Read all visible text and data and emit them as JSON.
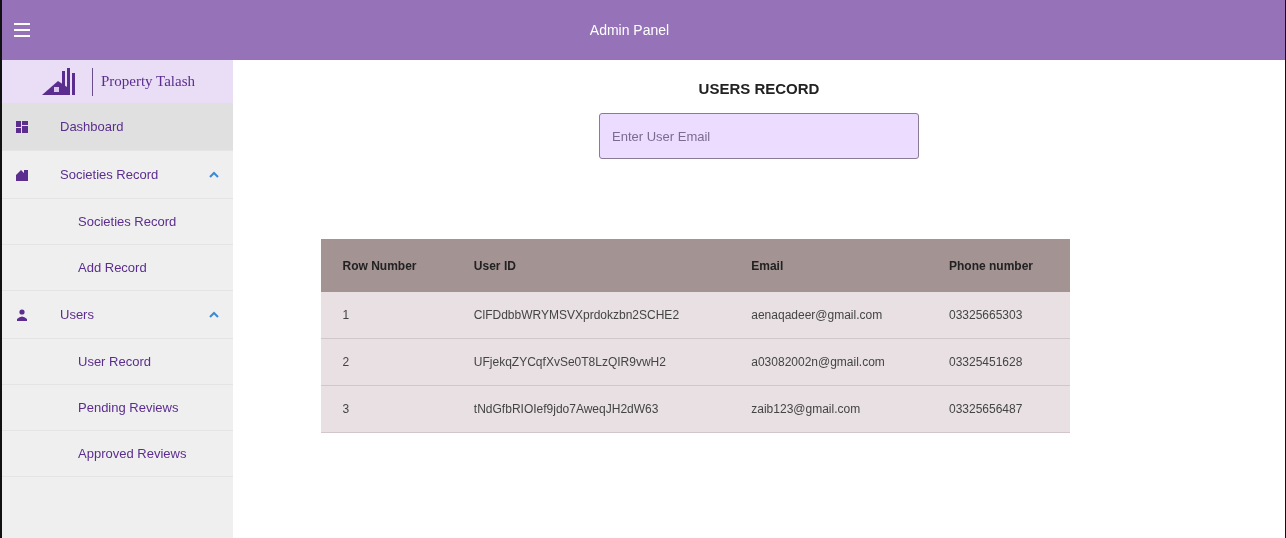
{
  "app_bar": {
    "title": "Admin Panel"
  },
  "sidebar": {
    "brand": "Property Talash",
    "items": [
      {
        "label": "Dashboard",
        "kind": "dashboard",
        "selected": true
      },
      {
        "label": "Societies Record",
        "kind": "building",
        "selected": false,
        "expanded": true,
        "children": [
          {
            "label": "Societies Record",
            "selected": false
          },
          {
            "label": "Add Record",
            "selected": false
          }
        ]
      },
      {
        "label": "Users",
        "kind": "person",
        "selected": false,
        "expanded": true,
        "children": [
          {
            "label": "User Record",
            "selected": false
          },
          {
            "label": "Pending Reviews",
            "selected": false
          },
          {
            "label": "Approved Reviews",
            "selected": false
          }
        ]
      }
    ]
  },
  "main": {
    "title": "USERS RECORD",
    "search": {
      "placeholder": "Enter User Email"
    },
    "table": {
      "columns": [
        "Row Number",
        "User ID",
        "Email",
        "Phone number"
      ],
      "rows": [
        [
          "1",
          "ClFDdbbWRYMSVXprdokzbn2SCHE2",
          "aenaqadeer@gmail.com",
          "03325665303"
        ],
        [
          "2",
          "UFjekqZYCqfXvSe0T8LzQIR9vwH2",
          "a03082002n@gmail.com",
          "03325451628"
        ],
        [
          "3",
          "tNdGfbRIOIef9jdo7AweqJH2dW63",
          "zaib123@gmail.com",
          "03325656487"
        ]
      ]
    }
  }
}
